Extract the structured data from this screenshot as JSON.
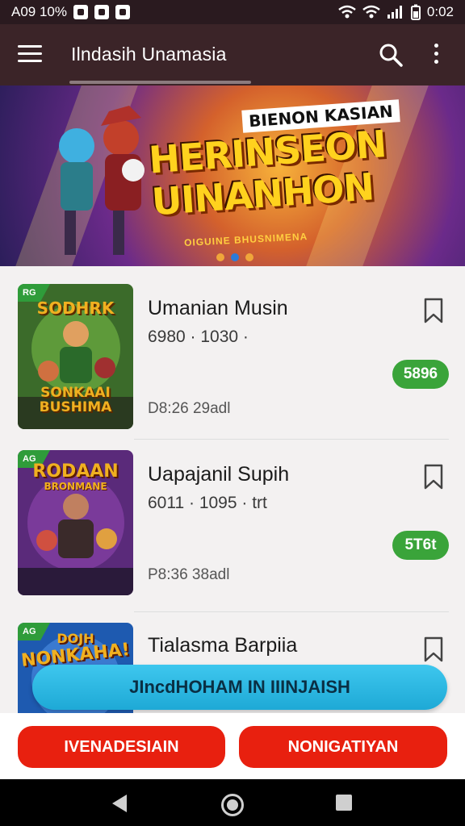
{
  "status_bar": {
    "left_text": "A09 10%",
    "time": "0:02",
    "icons": [
      "mail-icon",
      "lock-icon",
      "shield-icon",
      "wifi-icon",
      "wifi-call-icon",
      "signal-icon",
      "battery-icon"
    ]
  },
  "toolbar": {
    "title": "Ilndasih Unamasia",
    "icons": [
      "menu-icon",
      "search-icon",
      "more-vert-icon"
    ]
  },
  "banner": {
    "kicker": "BIENON KASIAN",
    "headline_line1": "HERINSEON",
    "headline_line2": "UINANHON",
    "subtitle": "OIGUINE BHUSNIMENA",
    "page_count": 3,
    "active_page": 2
  },
  "items": [
    {
      "tag": "RG",
      "thumb_title_top": "SODHRK",
      "thumb_title_bottom": "SONKAAI BUSHIMA",
      "name": "Umanian Musin",
      "meta": "6980 · 1030 ·",
      "date": "D8:26 29adl",
      "price": "5896",
      "colors": {
        "bg": "#3b6b2a",
        "accent": "#f0b020"
      }
    },
    {
      "tag": "AG",
      "thumb_title_top": "RODAAN",
      "thumb_title_bottom": "BRONMANE",
      "name": "Uapajanil Supih",
      "meta": "6011 · 1095 · trt",
      "date": "P8:36 38adl",
      "price": "5T6t",
      "colors": {
        "bg": "#5a2a7a",
        "accent": "#f0b020"
      }
    },
    {
      "tag": "AG",
      "thumb_title_top": "DOJH",
      "thumb_title_bottom": "NONKAHA!",
      "name": "Tialasma Barpiia",
      "meta": "",
      "date": "",
      "price": "",
      "colors": {
        "bg": "#1e5ab0",
        "accent": "#f0b020"
      }
    }
  ],
  "cta": {
    "label": "JIncdHOHAM IN IIINJAISH"
  },
  "bottom_buttons": {
    "left_label": "IVENADESIAIN",
    "right_label": "NONIGATIYAN",
    "color": "#e8200f"
  },
  "nav_bar": {
    "icons": [
      "back-icon",
      "home-icon",
      "recents-icon"
    ]
  }
}
